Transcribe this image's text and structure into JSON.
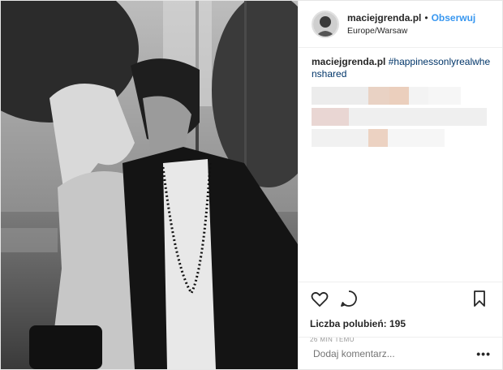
{
  "photo": {
    "description_icon": "photo-image"
  },
  "header": {
    "username": "maciejgrenda.pl",
    "separator": "•",
    "follow_label": "Obserwuj",
    "location": "Europe/Warsaw"
  },
  "caption": {
    "username": "maciejgrenda.pl",
    "hashtag": "#happinessonlyrealwhenshared"
  },
  "actions": {
    "like_icon": "heart-icon",
    "comment_icon": "comment-icon",
    "save_icon": "bookmark-icon",
    "likes_text": "Liczba polubień: 195",
    "timestamp": "26 MIN TEMU"
  },
  "comment_box": {
    "placeholder": "Dodaj komentarz...",
    "more_label": "•••"
  },
  "colors": {
    "link": "#3897f0",
    "hashtag": "#003569",
    "muted": "#999999",
    "border": "#efefef"
  }
}
